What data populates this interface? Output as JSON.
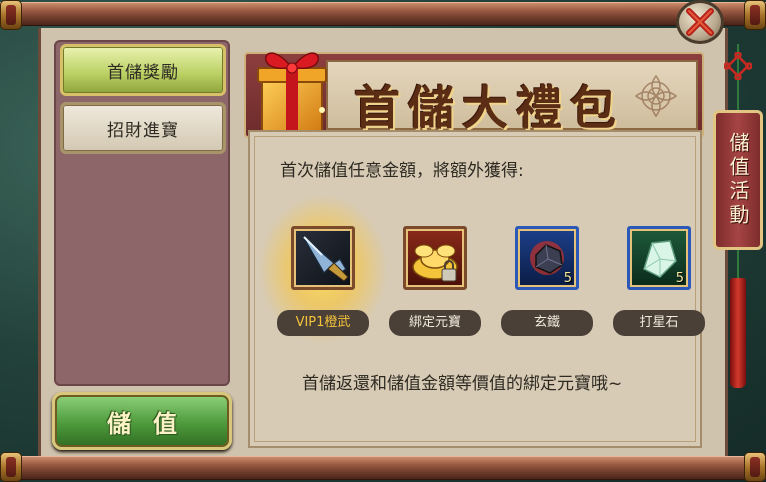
{
  "tabs": [
    {
      "label": "首儲獎勵",
      "active": true
    },
    {
      "label": "招財進寶",
      "active": false
    }
  ],
  "charge_button": {
    "label": "儲值"
  },
  "banner": {
    "title": "首儲大禮包"
  },
  "intro_text": "首次儲值任意金額，將額外獲得:",
  "rewards": [
    {
      "name": "VIP1橙武",
      "icon": "orange-weapon-icon",
      "count": "",
      "highlight": true
    },
    {
      "name": "綁定元寶",
      "icon": "gold-ingot-icon",
      "count": "",
      "highlight": false
    },
    {
      "name": "玄鐵",
      "icon": "black-iron-ore-icon",
      "count": "5",
      "highlight": false
    },
    {
      "name": "打星石",
      "icon": "star-stone-icon",
      "count": "5",
      "highlight": false
    }
  ],
  "description": "首儲返還和儲值金額等價值的綁定元寶哦~",
  "side_tag": {
    "label": "儲值活動"
  },
  "colors": {
    "parchment": "#d7cbb5",
    "menu_panel": "#8c6668",
    "banner_red": "#8d3e3e",
    "active_tab": "#b9cf62",
    "highlight_label": "#f4c33a"
  }
}
